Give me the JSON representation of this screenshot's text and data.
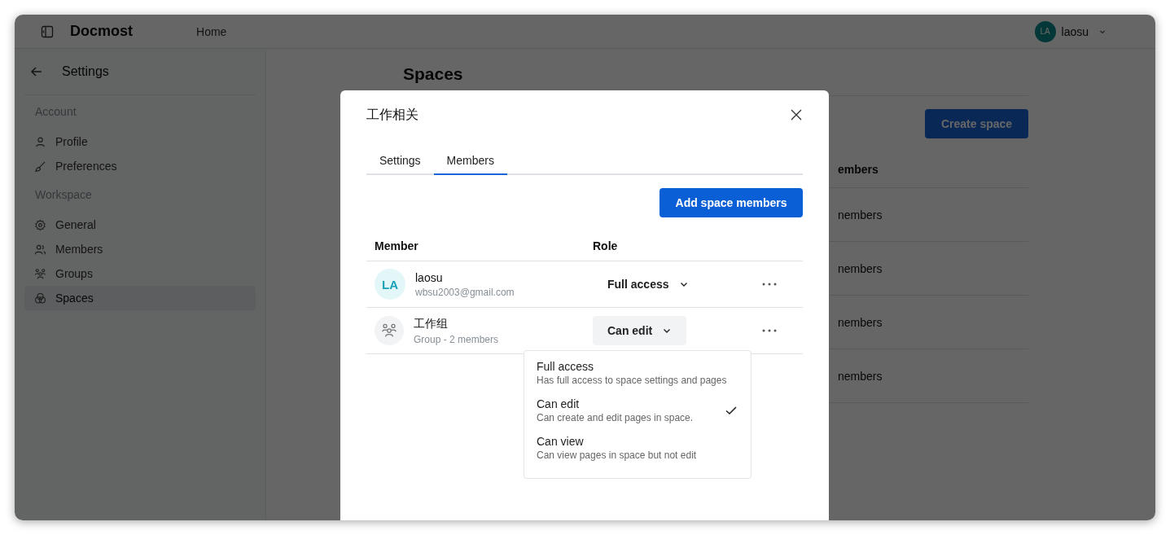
{
  "header": {
    "app_name": "Docmost",
    "nav": "Home",
    "user": {
      "initials": "LA",
      "name": "laosu"
    }
  },
  "sidebar": {
    "title": "Settings",
    "sections": [
      {
        "heading": "Account",
        "items": [
          {
            "label": "Profile",
            "kind": "profile",
            "selected": false
          },
          {
            "label": "Preferences",
            "kind": "preferences",
            "selected": false
          }
        ]
      },
      {
        "heading": "Workspace",
        "items": [
          {
            "label": "General",
            "kind": "general",
            "selected": false
          },
          {
            "label": "Members",
            "kind": "members",
            "selected": false
          },
          {
            "label": "Groups",
            "kind": "groups",
            "selected": false
          },
          {
            "label": "Spaces",
            "kind": "spaces",
            "selected": true
          }
        ]
      }
    ]
  },
  "main": {
    "title": "Spaces",
    "create_button": "Create space",
    "table": {
      "column_2": "embers",
      "rows": [
        "nembers",
        "nembers",
        "nembers",
        "nembers"
      ]
    }
  },
  "modal": {
    "title": "工作相关",
    "tabs": [
      {
        "label": "Settings",
        "selected": false
      },
      {
        "label": "Members",
        "selected": true
      }
    ],
    "add_button": "Add space members",
    "columns": [
      "Member",
      "Role"
    ],
    "members": [
      {
        "kind": "user",
        "initials": "LA",
        "name": "laosu",
        "subtitle": "wbsu2003@gmail.com",
        "role": "Full access",
        "expanded": false
      },
      {
        "kind": "group",
        "name": "工作组",
        "subtitle": "Group - 2 members",
        "role": "Can edit",
        "expanded": true
      }
    ],
    "role_options": [
      {
        "label": "Full access",
        "description": "Has full access to space settings and pages",
        "selected": false
      },
      {
        "label": "Can edit",
        "description": "Can create and edit pages in space.",
        "selected": true
      },
      {
        "label": "Can view",
        "description": "Can view pages in space but not edit",
        "selected": false
      }
    ]
  }
}
